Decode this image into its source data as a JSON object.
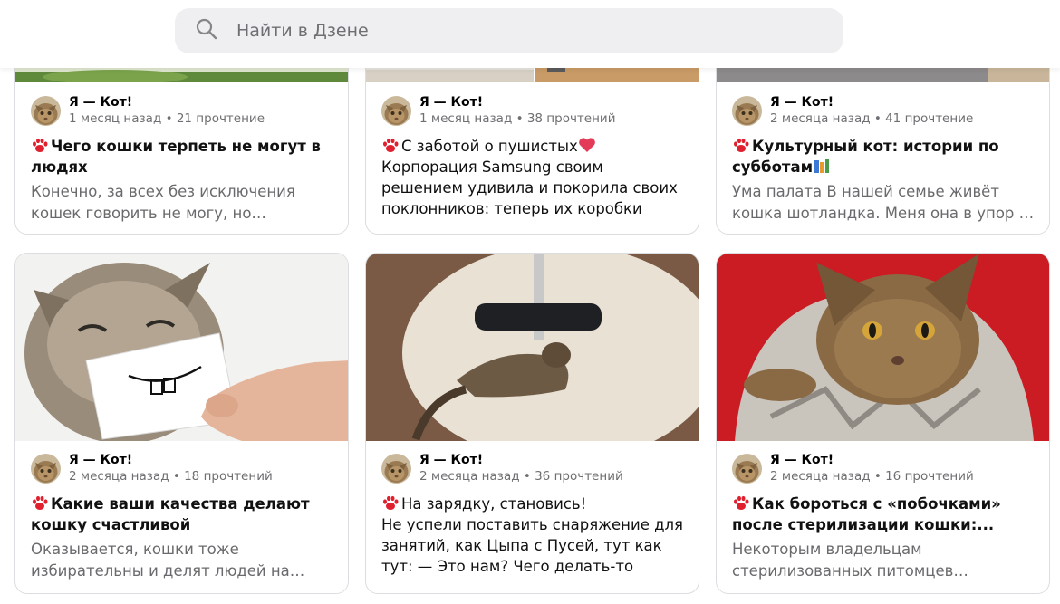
{
  "search": {
    "placeholder": "Найти в Дзене"
  },
  "icons": {
    "search": "search-icon",
    "paw": "paw-icon",
    "heart": "heart-icon",
    "books": "books-icon"
  },
  "accent": {
    "paw": "#e0202e"
  },
  "cards": [
    {
      "author": "Я — Кот!",
      "stats": "1 месяц назад • 21 прочтение",
      "title": "Чего кошки терпеть не могут в людях",
      "description": "Конечно, за всех без исключения кошек говорить не могу, но…"
    },
    {
      "author": "Я — Кот!",
      "stats": "1 месяц назад • 38 прочтений",
      "title": "С заботой о пушистых",
      "snippet": "Корпорация Samsung своим решением удивила и покорила своих поклонников: теперь их коробки для…"
    },
    {
      "author": "Я — Кот!",
      "stats": "2 месяца назад • 41 прочтение",
      "title": "Культурный кот: истории по субботам",
      "description": "Ума палата В нашей семье живёт кошка шотландка. Меня она в упор …"
    },
    {
      "author": "Я — Кот!",
      "stats": "2 месяца назад • 18 прочтений",
      "title": "Какие ваши качества делают кошку счастливой",
      "description": "Оказывается, кошки тоже избирательны и делят людей на…"
    },
    {
      "author": "Я — Кот!",
      "stats": "2 месяца назад • 36 прочтений",
      "title": "На зарядку, становись!",
      "snippet": "Не успели поставить снаряжение для занятий, как Цыпа с Пусей, тут как тут: — Это нам? Чего делать-то надо?..."
    },
    {
      "author": "Я — Кот!",
      "stats": "2 месяца назад • 16 прочтений",
      "title": "Как бороться с «побочками» после стерилизации кошки:...",
      "description": "Некоторым владельцам стерилизованных питомцев…"
    }
  ]
}
